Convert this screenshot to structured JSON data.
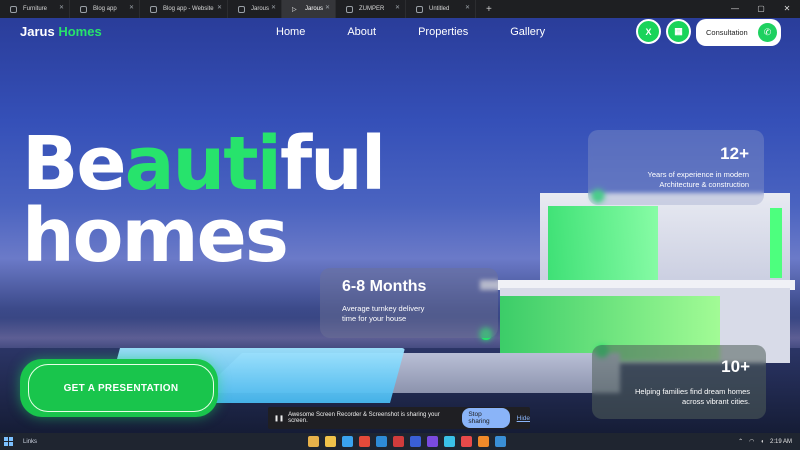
{
  "browser": {
    "tabs": [
      {
        "label": "Furniture",
        "active": false
      },
      {
        "label": "Blog app",
        "active": false
      },
      {
        "label": "Blog app - Website",
        "active": false
      },
      {
        "label": "Jarous",
        "active": false
      },
      {
        "label": "Jarous",
        "active": true
      },
      {
        "label": "ZUMPER",
        "active": false
      },
      {
        "label": "Untitled",
        "active": false
      }
    ],
    "new_tab": "+",
    "window_controls": [
      "—",
      "▢",
      "✕"
    ]
  },
  "header": {
    "logo_primary": "Jarus",
    "logo_accent": "Homes",
    "nav": [
      "Home",
      "About",
      "Properties",
      "Gallery"
    ],
    "social": [
      {
        "icon": "x-icon",
        "glyph": "X"
      },
      {
        "icon": "grid-icon",
        "glyph": "▦"
      }
    ],
    "consultation_label": "Consultation",
    "phone_glyph": "✆"
  },
  "hero": {
    "headline_part1": "Be",
    "headline_accent1": "auti",
    "headline_part2": "ful",
    "headline_line2": "homes",
    "cta_label": "GET A PRESENTATION"
  },
  "stats": [
    {
      "number": "12+",
      "desc_line1": "Years of experience in modern",
      "desc_line2": "Architecture & construction"
    },
    {
      "number": "6-8 Months",
      "desc_line1": "Average turnkey delivery",
      "desc_line2": "time for your house"
    },
    {
      "number": "10+",
      "desc_line1": "Helping families find dream homes",
      "desc_line2": "across vibrant cities."
    }
  ],
  "share_banner": {
    "message": "Awesome Screen Recorder & Screenshot is sharing your screen.",
    "stop_label": "Stop sharing",
    "hide_label": "Hide"
  },
  "taskbar": {
    "weather": "Links",
    "time": "2:19 AM",
    "icon_colors": [
      "#e8b24a",
      "#f0c24a",
      "#3aa3f0",
      "#e34a3a",
      "#2e8bd6",
      "#d13c3c",
      "#3a5fd6",
      "#7a4adf",
      "#3ac1e8",
      "#e84a4a",
      "#f08a2a",
      "#3a8fd6"
    ]
  },
  "colors": {
    "accent": "#27e36c",
    "sky": "#3550b8"
  }
}
